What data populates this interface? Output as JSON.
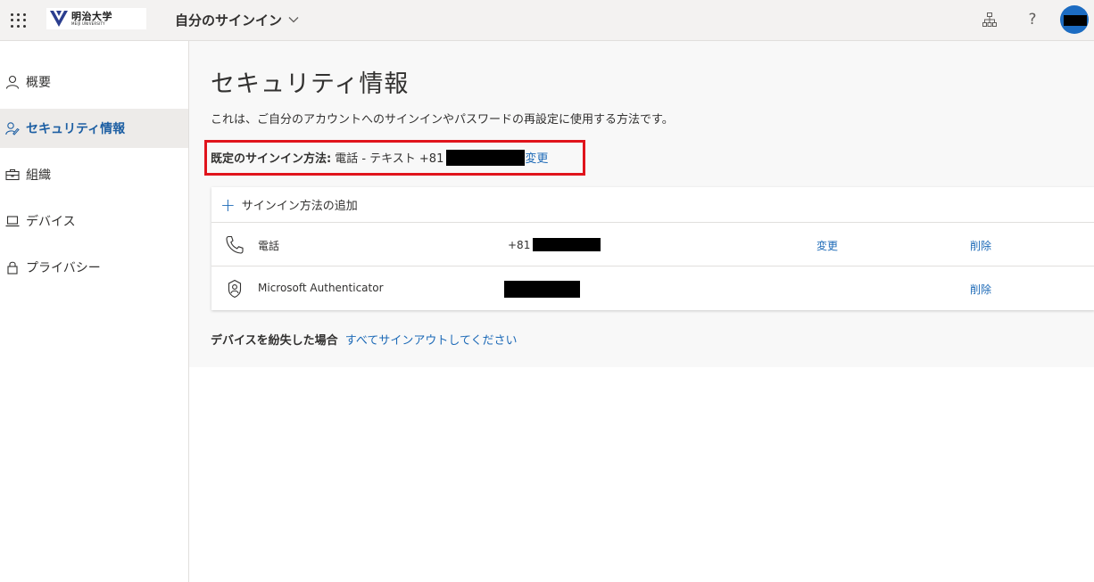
{
  "header": {
    "app_title": "自分のサインイン",
    "logo": {
      "main": "明治大学",
      "sub": "MEIJI UNIVERSITY"
    },
    "help_symbol": "?",
    "icons": [
      "waffle-icon",
      "chevron-down-icon",
      "org-chart-icon",
      "help-icon"
    ]
  },
  "sidebar": {
    "items": [
      {
        "label": "概要",
        "icon": "person-icon",
        "active": false
      },
      {
        "label": "セキュリティ情報",
        "icon": "security-info-icon",
        "active": true
      },
      {
        "label": "組織",
        "icon": "briefcase-icon",
        "active": false
      },
      {
        "label": "デバイス",
        "icon": "laptop-icon",
        "active": false
      },
      {
        "label": "プライバシー",
        "icon": "lock-icon",
        "active": false
      }
    ]
  },
  "main": {
    "title": "セキュリティ情報",
    "description": "これは、ご自分のアカウントへのサインインやパスワードの再設定に使用する方法です。",
    "default_method": {
      "label": "既定のサインイン方法:",
      "value": "電話 - テキスト +81",
      "change": "変更"
    },
    "add_method": "サインイン方法の追加",
    "methods": [
      {
        "name": "電話",
        "value": "+81",
        "change": "変更",
        "delete": "削除",
        "icon": "phone-icon"
      },
      {
        "name": "Microsoft Authenticator",
        "value": "",
        "change": "",
        "delete": "削除",
        "icon": "authenticator-icon"
      }
    ],
    "lost_device": {
      "label": "デバイスを紛失した場合",
      "link": "すべてサインアウトしてください"
    }
  },
  "colors": {
    "accent": "#1d6ab7",
    "highlight_border": "#e0141c",
    "header_bg": "#f3f2f1",
    "active_nav_bg": "#edebe9",
    "avatar": "#1c6cc2"
  }
}
